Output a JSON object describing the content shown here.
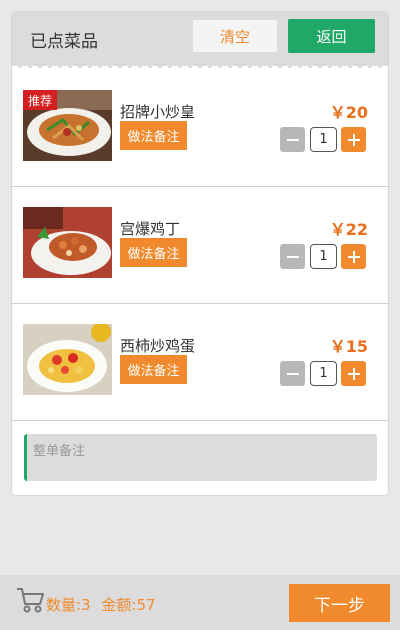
{
  "header": {
    "title": "已点菜品",
    "clear_label": "清空",
    "back_label": "返回"
  },
  "dishes": [
    {
      "name": "招牌小炒皇",
      "note_label": "做法备注",
      "price": "￥20",
      "quantity": "1",
      "badge": "推荐"
    },
    {
      "name": "宫爆鸡丁",
      "note_label": "做法备注",
      "price": "￥22",
      "quantity": "1"
    },
    {
      "name": "西柿炒鸡蛋",
      "note_label": "做法备注",
      "price": "￥15",
      "quantity": "1"
    }
  ],
  "order_note": {
    "placeholder": "整单备注"
  },
  "footer": {
    "count_text": "数量:3",
    "amount_text": "金额:57",
    "next_label": "下一步"
  },
  "colors": {
    "accent": "#f08a2c",
    "green": "#1fa866",
    "price": "#ea6f1a",
    "badge": "#d42020"
  },
  "icons": {
    "cart": "cart-icon",
    "minus": "minus-icon",
    "plus": "plus-icon"
  }
}
